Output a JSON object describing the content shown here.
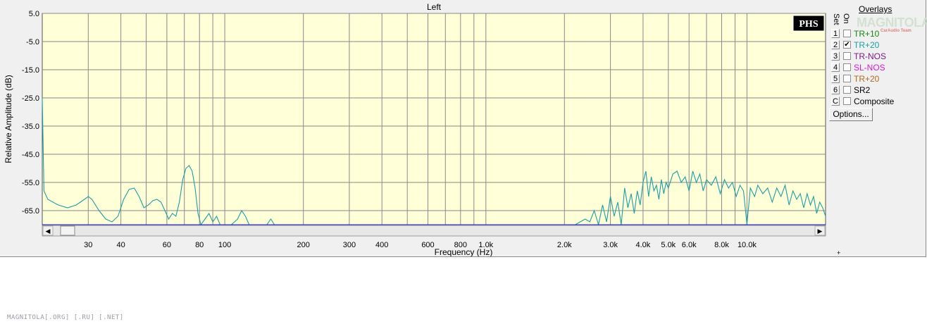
{
  "chart_data": {
    "type": "line",
    "title": "Left",
    "xlabel": "Frequency (Hz)",
    "ylabel": "Relative Amplitude (dB)",
    "x_scale": "log",
    "xlim": [
      20,
      20000
    ],
    "ylim": [
      -70,
      5
    ],
    "grid": true,
    "y_ticks": [
      "5.0",
      "-5.0",
      "-15.0",
      "-25.0",
      "-35.0",
      "-45.0",
      "-55.0",
      "-65.0"
    ],
    "x_ticks": [
      {
        "v": 30,
        "label": "30"
      },
      {
        "v": 40,
        "label": "40"
      },
      {
        "v": 60,
        "label": "60"
      },
      {
        "v": 80,
        "label": "80"
      },
      {
        "v": 100,
        "label": "100"
      },
      {
        "v": 200,
        "label": "200"
      },
      {
        "v": 300,
        "label": "300"
      },
      {
        "v": 400,
        "label": "400"
      },
      {
        "v": 600,
        "label": "600"
      },
      {
        "v": 800,
        "label": "800"
      },
      {
        "v": 1000,
        "label": "1.0k"
      },
      {
        "v": 2000,
        "label": "2.0k"
      },
      {
        "v": 3000,
        "label": "3.0k"
      },
      {
        "v": 4000,
        "label": "4.0k"
      },
      {
        "v": 5000,
        "label": "5.0k"
      },
      {
        "v": 6000,
        "label": "6.0k"
      },
      {
        "v": 8000,
        "label": "8.0k"
      },
      {
        "v": 10000,
        "label": "10.0k"
      }
    ],
    "series": [
      {
        "name": "TR+20",
        "color": "#1a9fa8",
        "points": [
          [
            20,
            -25
          ],
          [
            20.3,
            -58
          ],
          [
            21,
            -61
          ],
          [
            23,
            -63
          ],
          [
            25,
            -64
          ],
          [
            27,
            -63
          ],
          [
            29,
            -61
          ],
          [
            30,
            -60
          ],
          [
            31,
            -61
          ],
          [
            33,
            -65
          ],
          [
            35,
            -68
          ],
          [
            37,
            -69
          ],
          [
            39,
            -67
          ],
          [
            41,
            -61
          ],
          [
            43,
            -57.5
          ],
          [
            45,
            -57
          ],
          [
            47,
            -60
          ],
          [
            49,
            -64
          ],
          [
            51,
            -63
          ],
          [
            53,
            -61.5
          ],
          [
            55,
            -61
          ],
          [
            57,
            -62
          ],
          [
            59,
            -65
          ],
          [
            61,
            -68
          ],
          [
            63,
            -66
          ],
          [
            65,
            -67
          ],
          [
            67,
            -62
          ],
          [
            69,
            -54
          ],
          [
            71,
            -50
          ],
          [
            73,
            -49
          ],
          [
            75,
            -51
          ],
          [
            77,
            -57
          ],
          [
            79,
            -66
          ],
          [
            81,
            -70
          ],
          [
            84,
            -68
          ],
          [
            87,
            -66
          ],
          [
            90,
            -69
          ],
          [
            93,
            -67
          ],
          [
            96,
            -70
          ],
          [
            100,
            -70
          ],
          [
            106,
            -70
          ],
          [
            112,
            -68
          ],
          [
            116,
            -65
          ],
          [
            120,
            -67
          ],
          [
            124,
            -70
          ],
          [
            135,
            -70
          ],
          [
            145,
            -70
          ],
          [
            150,
            -68
          ],
          [
            155,
            -70
          ],
          [
            170,
            -70
          ],
          [
            250,
            -70
          ],
          [
            500,
            -70
          ],
          [
            1000,
            -70
          ],
          [
            1600,
            -70
          ],
          [
            2200,
            -70
          ],
          [
            2400,
            -68
          ],
          [
            2500,
            -69
          ],
          [
            2600,
            -65
          ],
          [
            2700,
            -70
          ],
          [
            2800,
            -63
          ],
          [
            2900,
            -69
          ],
          [
            3000,
            -60
          ],
          [
            3100,
            -67
          ],
          [
            3200,
            -62
          ],
          [
            3300,
            -70
          ],
          [
            3400,
            -57
          ],
          [
            3500,
            -64
          ],
          [
            3600,
            -59
          ],
          [
            3700,
            -66
          ],
          [
            3800,
            -58
          ],
          [
            3900,
            -63
          ],
          [
            4000,
            -55
          ],
          [
            4100,
            -51
          ],
          [
            4200,
            -60
          ],
          [
            4300,
            -53
          ],
          [
            4400,
            -58
          ],
          [
            4500,
            -56
          ],
          [
            4600,
            -61
          ],
          [
            4700,
            -54
          ],
          [
            4800,
            -59
          ],
          [
            4900,
            -55
          ],
          [
            5000,
            -57
          ],
          [
            5200,
            -52
          ],
          [
            5400,
            -51
          ],
          [
            5600,
            -55
          ],
          [
            5800,
            -53
          ],
          [
            6000,
            -58
          ],
          [
            6200,
            -51
          ],
          [
            6400,
            -55
          ],
          [
            6600,
            -52
          ],
          [
            6800,
            -58
          ],
          [
            7000,
            -54
          ],
          [
            7300,
            -56
          ],
          [
            7600,
            -53
          ],
          [
            7900,
            -59
          ],
          [
            8200,
            -54
          ],
          [
            8500,
            -57
          ],
          [
            8800,
            -55
          ],
          [
            9100,
            -60
          ],
          [
            9400,
            -56
          ],
          [
            9700,
            -58
          ],
          [
            10000,
            -70
          ],
          [
            10300,
            -57
          ],
          [
            10700,
            -60
          ],
          [
            11000,
            -56
          ],
          [
            11500,
            -59
          ],
          [
            12000,
            -57
          ],
          [
            12500,
            -62
          ],
          [
            13000,
            -57
          ],
          [
            13500,
            -60
          ],
          [
            14000,
            -56
          ],
          [
            14500,
            -63
          ],
          [
            15000,
            -58
          ],
          [
            15500,
            -61
          ],
          [
            16000,
            -59
          ],
          [
            16500,
            -64
          ],
          [
            17000,
            -59
          ],
          [
            17500,
            -63
          ],
          [
            18000,
            -60
          ],
          [
            18500,
            -66
          ],
          [
            19000,
            -62
          ],
          [
            19500,
            -64
          ],
          [
            20000,
            -67
          ]
        ]
      }
    ]
  },
  "overlays": {
    "title": "Overlays",
    "header_set": "Set",
    "header_on": "On",
    "items": [
      {
        "set": "1",
        "checked": false,
        "mark": "",
        "label": "TR+10",
        "color": "#118a11"
      },
      {
        "set": "2",
        "checked": true,
        "mark": "✔",
        "label": "TR+20",
        "color": "#1a9fa8"
      },
      {
        "set": "3",
        "checked": false,
        "mark": "",
        "label": "TR-NOS",
        "color": "#7a1a8a"
      },
      {
        "set": "4",
        "checked": false,
        "mark": "",
        "label": "SL-NOS",
        "color": "#d020d0"
      },
      {
        "set": "5",
        "checked": false,
        "mark": "",
        "label": "TR+20",
        "color": "#b06a20"
      },
      {
        "set": "6",
        "checked": false,
        "mark": "",
        "label": "SR2",
        "color": "#000000"
      },
      {
        "set": "C",
        "checked": false,
        "mark": "",
        "label": "Composite",
        "color": "#000000"
      }
    ],
    "options_label": "Options..."
  },
  "badge": "PHS",
  "watermark": {
    "logo": "MAGNITOLA",
    "sub": "CarAudio Team"
  },
  "footer": "MAGNITOLA[.ORG] [.RU] [.NET]",
  "scroll": {
    "left_arrow": "◀",
    "right_arrow": "▶"
  },
  "resize_glyph": "+",
  "colors": {
    "plot_bg": "#ffffd8",
    "grid": "#8a8a8a",
    "trace": "#1a9fa8",
    "axis_base": "#1a1ad0"
  }
}
